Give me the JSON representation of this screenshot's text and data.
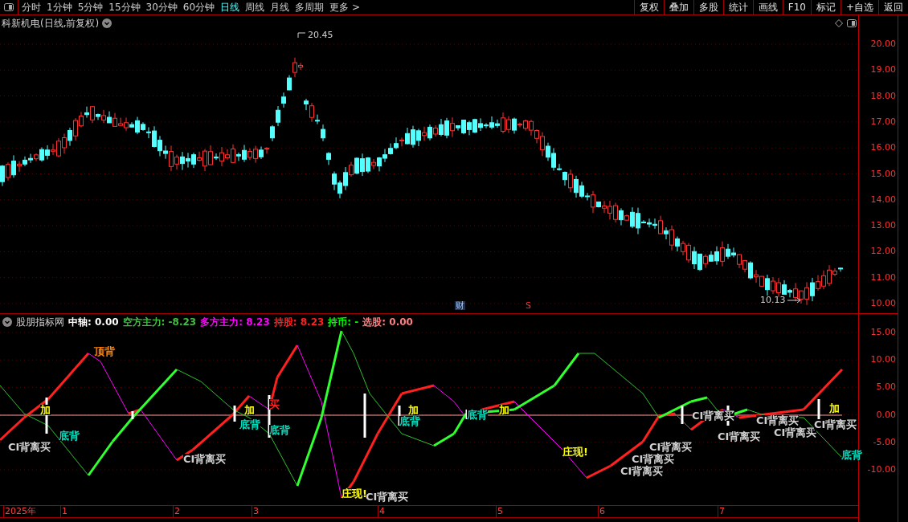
{
  "toolbar": {
    "periods": [
      {
        "label": "分时",
        "selected": false
      },
      {
        "label": "1分钟",
        "selected": false
      },
      {
        "label": "5分钟",
        "selected": false
      },
      {
        "label": "15分钟",
        "selected": false
      },
      {
        "label": "30分钟",
        "selected": false
      },
      {
        "label": "60分钟",
        "selected": false
      },
      {
        "label": "日线",
        "selected": true
      },
      {
        "label": "周线",
        "selected": false
      },
      {
        "label": "月线",
        "selected": false
      },
      {
        "label": "多周期",
        "selected": false
      },
      {
        "label": "更多 >",
        "selected": false
      }
    ],
    "buttons": [
      "复权",
      "叠加",
      "多股",
      "统计",
      "画线",
      "F10",
      "标记",
      "+自选",
      "返回"
    ]
  },
  "main_chart": {
    "title": "科新机电(日线,前复权)",
    "high_label": "20.45",
    "low_label": "10.13",
    "markers": [
      {
        "label": "财",
        "kind": "finance"
      },
      {
        "label": "S",
        "kind": "signal"
      }
    ],
    "yaxis": [
      "20.00",
      "19.00",
      "18.00",
      "17.00",
      "16.00",
      "15.00",
      "14.00",
      "13.00",
      "12.00",
      "11.00",
      "10.00"
    ]
  },
  "indicator": {
    "name": "股朋指标网",
    "values": [
      {
        "label": "中轴: 0.00",
        "color": "#ffffff"
      },
      {
        "label": "空方主力: -8.23",
        "color": "#40c040"
      },
      {
        "label": "多方主力: 8.23",
        "color": "#ff00ff"
      },
      {
        "label": "持股: 8.23",
        "color": "#ff2020"
      },
      {
        "label": "持币: -",
        "color": "#00ff00"
      },
      {
        "label": "选股: 0.00",
        "color": "#ff8080"
      }
    ],
    "labels": [
      {
        "text": "顶背",
        "color": "#ff8000"
      },
      {
        "text": "底背",
        "color": "#00e0c0"
      },
      {
        "text": "CI背离买",
        "color": "#d0d0d0"
      },
      {
        "text": "加",
        "color": "#ffff00"
      },
      {
        "text": "CI背离买",
        "color": "#d0d0d0"
      },
      {
        "text": "加",
        "color": "#ffff00"
      },
      {
        "text": "底背",
        "color": "#00e0c0"
      },
      {
        "text": "买",
        "color": "#ff2020"
      },
      {
        "text": "底背",
        "color": "#00e0c0"
      },
      {
        "text": "庄现!",
        "color": "#ffff00"
      },
      {
        "text": "CI背离买",
        "color": "#d0d0d0"
      },
      {
        "text": "加",
        "color": "#ffff00"
      },
      {
        "text": "底背",
        "color": "#00e0c0"
      },
      {
        "text": "底背",
        "color": "#00e0c0"
      },
      {
        "text": "加",
        "color": "#ffff00"
      },
      {
        "text": "庄现!",
        "color": "#ffff00"
      },
      {
        "text": "CI背离买",
        "color": "#d0d0d0"
      },
      {
        "text": "CI背离买",
        "color": "#d0d0d0"
      },
      {
        "text": "CI背离买",
        "color": "#d0d0d0"
      },
      {
        "text": "CI背离买",
        "color": "#d0d0d0"
      },
      {
        "text": "CI背离买",
        "color": "#d0d0d0"
      },
      {
        "text": "CI背离买",
        "color": "#d0d0d0"
      },
      {
        "text": "CI背离买",
        "color": "#d0d0d0"
      },
      {
        "text": "CI背离买",
        "color": "#d0d0d0"
      },
      {
        "text": "加",
        "color": "#ffff00"
      },
      {
        "text": "底背",
        "color": "#00e0c0"
      }
    ],
    "yaxis": [
      "15.00",
      "10.00",
      "5.00",
      "0.00",
      "-5.00",
      "-10.00"
    ]
  },
  "time_axis": [
    "2025年",
    "1",
    "2",
    "3",
    "4",
    "5",
    "6",
    "7"
  ]
}
